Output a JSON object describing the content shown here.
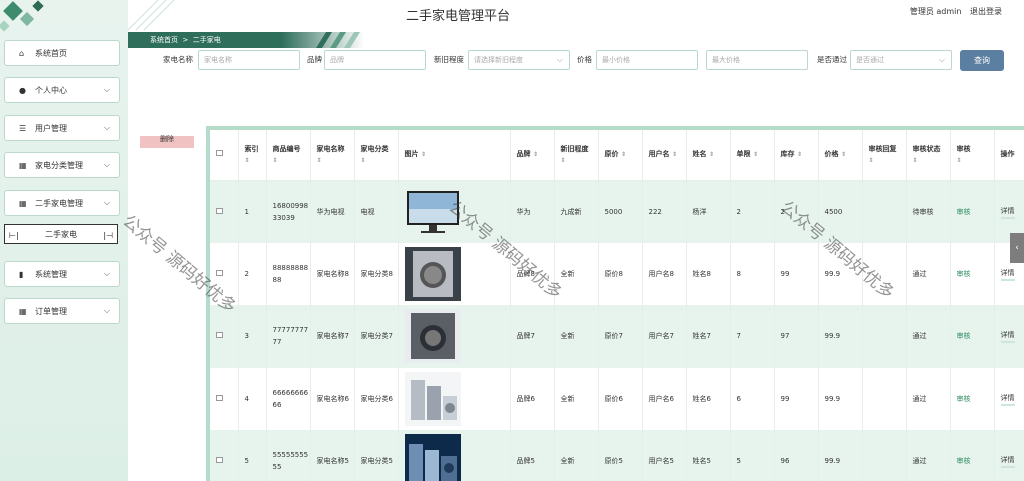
{
  "header": {
    "title": "二手家电管理平台",
    "user_label": "管理员 admin",
    "logout": "退出登录"
  },
  "breadcrumb": {
    "home": "系统首页",
    "sep": ">",
    "current": "二手家电"
  },
  "sidebar": {
    "items": [
      {
        "label": "系统首页",
        "icon": "home-icon",
        "glyph": "⌂",
        "chevron": false
      },
      {
        "label": "个人中心",
        "icon": "person-icon",
        "glyph": "●",
        "chevron": true
      },
      {
        "label": "用户管理",
        "icon": "sliders-icon",
        "glyph": "☰",
        "chevron": true
      },
      {
        "label": "家电分类管理",
        "icon": "grid-icon",
        "glyph": "▦",
        "chevron": true
      },
      {
        "label": "二手家电管理",
        "icon": "grid-icon",
        "glyph": "▦",
        "chevron": true
      },
      {
        "label": "系统管理",
        "icon": "bar-chart-icon",
        "glyph": "▮",
        "chevron": true
      },
      {
        "label": "订单管理",
        "icon": "grid-icon",
        "glyph": "▦",
        "chevron": true
      }
    ],
    "sub_item": "二手家电"
  },
  "filters": {
    "name_label": "家电名称",
    "name_placeholder": "家电名称",
    "brand_label": "品牌",
    "brand_placeholder": "品牌",
    "condition_label": "新旧程度",
    "condition_placeholder": "请选择新旧程度",
    "price_label": "价格",
    "min_placeholder": "最小价格",
    "max_placeholder": "最大价格",
    "pass_label": "是否通过",
    "pass_placeholder": "是否通过",
    "query_button": "查询"
  },
  "delete_button": "删除",
  "table": {
    "headers": {
      "index": "索引",
      "code": "商品编号",
      "name": "家电名称",
      "category": "家电分类",
      "image": "图片",
      "brand": "品牌",
      "condition": "新旧程度",
      "original_price": "原价",
      "username": "用户名",
      "real_name": "姓名",
      "years": "单限",
      "stock": "库存",
      "price": "价格",
      "reply": "审核回复",
      "status": "审核状态",
      "audit": "审核",
      "action": "操作"
    },
    "rows": [
      {
        "index": "1",
        "code": "1680099833039",
        "name": "华为电视",
        "category": "电视",
        "image": "tv-image",
        "brand": "华为",
        "condition": "九成新",
        "original_price": "5000",
        "username": "222",
        "real_name": "杨洋",
        "years": "2",
        "stock": "2",
        "price": "4500",
        "reply": "",
        "status": "待审核",
        "audit": "审核",
        "action": "详情"
      },
      {
        "index": "2",
        "code": "8888888888",
        "name": "家电名称8",
        "category": "家电分类8",
        "image": "washer-image",
        "brand": "品牌8",
        "condition": "全新",
        "original_price": "原价8",
        "username": "用户名8",
        "real_name": "姓名8",
        "years": "8",
        "stock": "99",
        "price": "99.9",
        "reply": "",
        "status": "通过",
        "audit": "审核",
        "action": "详情"
      },
      {
        "index": "3",
        "code": "7777777777",
        "name": "家电名称7",
        "category": "家电分类7",
        "image": "dryer-image",
        "brand": "品牌7",
        "condition": "全新",
        "original_price": "原价7",
        "username": "用户名7",
        "real_name": "姓名7",
        "years": "7",
        "stock": "97",
        "price": "99.9",
        "reply": "",
        "status": "通过",
        "audit": "审核",
        "action": "详情"
      },
      {
        "index": "4",
        "code": "6666666666",
        "name": "家电名称6",
        "category": "家电分类6",
        "image": "appliances-image",
        "brand": "品牌6",
        "condition": "全新",
        "original_price": "原价6",
        "username": "用户名6",
        "real_name": "姓名6",
        "years": "6",
        "stock": "99",
        "price": "99.9",
        "reply": "",
        "status": "通过",
        "audit": "审核",
        "action": "详情"
      },
      {
        "index": "5",
        "code": "5555555555",
        "name": "家电名称5",
        "category": "家电分类5",
        "image": "appliance-set-image",
        "brand": "品牌5",
        "condition": "全新",
        "original_price": "原价5",
        "username": "用户名5",
        "real_name": "姓名5",
        "years": "5",
        "stock": "96",
        "price": "99.9",
        "reply": "",
        "status": "通过",
        "audit": "审核",
        "action": "详情"
      }
    ]
  },
  "watermark": "公众号 源码好优多",
  "colors": {
    "accent": "#2f6e5b",
    "query_button": "#5b7fa0",
    "delete_button": "#f0c2c2",
    "row_alt": "#e7f4ee"
  }
}
